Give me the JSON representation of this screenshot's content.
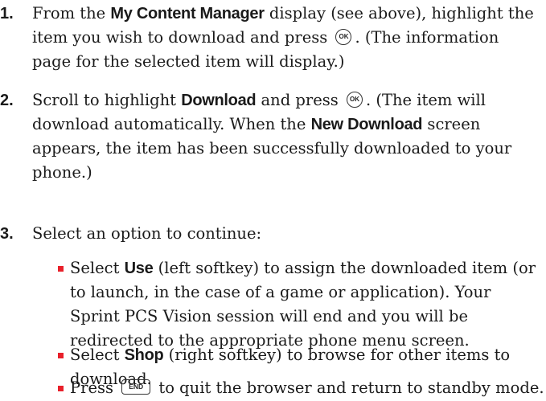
{
  "steps": [
    {
      "number": "1.",
      "parts": {
        "t1": "From the ",
        "b1": "My Content Manager",
        "t2": " display (see above), highlight the item you wish to download and press ",
        "key": "OK",
        "t3": ". (The information page for the selected item will display.)"
      }
    },
    {
      "number": "2.",
      "parts": {
        "t1": "Scroll to highlight ",
        "b1": "Download",
        "t2": " and press ",
        "key": "OK",
        "t3": ". (The item will download automatically. When the ",
        "b2": "New Download",
        "t4": " screen appears, the item has been successfully downloaded to your phone.)"
      }
    },
    {
      "number": "3.",
      "parts": {
        "t1": "Select an option to continue:"
      }
    }
  ],
  "bullets": [
    {
      "t1": "Select ",
      "b1": "Use",
      "t2": " (left softkey) to assign the downloaded item (or to launch, in the case of a game or application). Your Sprint PCS Vision session will end and you will be redirected to the appropriate phone menu screen."
    },
    {
      "t1": "Select ",
      "b1": "Shop",
      "t2": " (right softkey) to browse for other items to download."
    },
    {
      "t1": "Press ",
      "key": "END",
      "t2": " to quit the browser and return to standby mode."
    }
  ],
  "colors": {
    "bullet": "#e8202a",
    "text": "#1a1a1a"
  }
}
